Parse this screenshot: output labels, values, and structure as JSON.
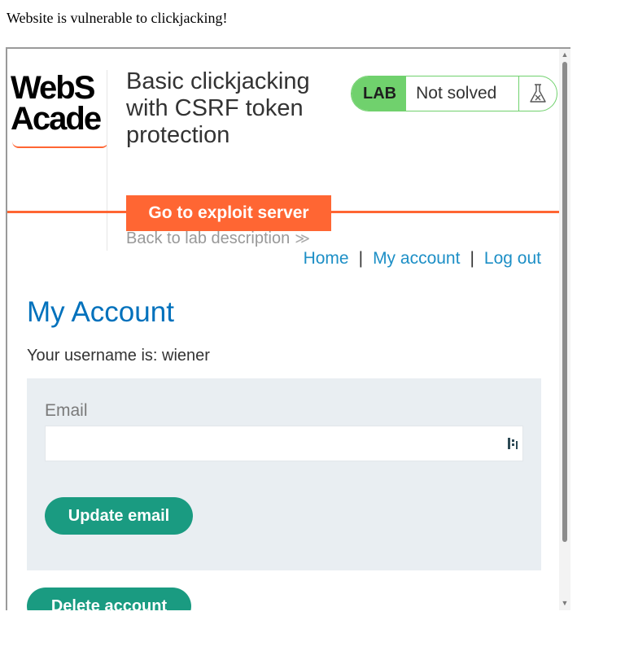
{
  "outer": {
    "message": "Website is vulnerable to clickjacking!"
  },
  "header": {
    "logo_line1": "WebS",
    "logo_line2": "Acade",
    "lab_title": "Basic clickjacking with CSRF token protection",
    "lab_badge": "LAB",
    "lab_status": "Not solved",
    "exploit_button": "Go to exploit server",
    "back_link": "Back to lab description",
    "back_chevron": "≫",
    "accent_color": "#ff6633",
    "status_color": "#70d16d"
  },
  "nav": {
    "home": "Home",
    "separator": "|",
    "my_account": "My account",
    "log_out": "Log out"
  },
  "main": {
    "title": "My Account",
    "username_text": "Your username is: wiener",
    "email_label": "Email",
    "email_value": "",
    "update_button": "Update email",
    "delete_button": "Delete account",
    "button_color": "#1a9b81",
    "title_color": "#0071bc"
  },
  "icons": {
    "flask": "flask-icon",
    "password_manager": "password-manager-icon",
    "scroll_up": "▲",
    "scroll_down": "▼"
  }
}
